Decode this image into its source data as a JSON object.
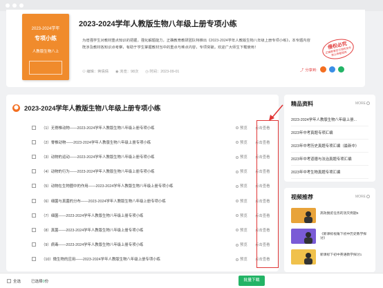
{
  "header": {
    "cover": {
      "year": "2023-2024学年",
      "title": "专项小练",
      "subtitle": "人教版生物八上"
    },
    "title": "2023-2024学年人教版生物八年级上册专项小练",
    "description": "为增强学生对教材重点知识的把握，强化解题能力，正确教育教研团队特推出《2023-2024学年人教版生物八年级上册专项小练》，本专题内容既涉及教材各知识点考察，有助于学生掌握教材当中的重点与难点内容，专项突破。欢迎广大师生下载使用！",
    "meta": {
      "editor_label": "编辑：",
      "editor": "蒋倩倩",
      "views_label": "浏览：",
      "views": "98次",
      "time_label": "时间：",
      "time": "2023-09-01"
    },
    "stamp": {
      "main": "侵权必究",
      "line1": "正确教育官方授权发布",
      "line2": "禁止转载使用"
    },
    "share_label": "分享到:"
  },
  "main": {
    "badge": "",
    "title": "2023-2024学年人教版生物八年级上册专项小练",
    "preview_label": "预览",
    "view_label": "点击查看",
    "items": [
      "（1）无脊椎动物——2023-2024学年人教版生物八年级上册专项小练",
      "（2）脊椎动物——2023-2024学年人教版生物八年级上册专项小练",
      "（3）动物的运动——2023-2024学年人教版生物八年级上册专项小练",
      "（4）动物的行为——2023-2024学年人教版生物八年级上册专项小练",
      "（5）动物在生物圈中的作用——2023-2024学年人教版生物八年级上册专项小练",
      "（6）细菌与真菌的分布——2023-2024学年人教版生物八年级上册专项小练",
      "（7）细菌——2023-2024学年人教版生物八年级上册专项小练",
      "（8）真菌——2023-2024学年人教版生物八年级上册专项小练",
      "（9）病毒——2023-2024学年人教版生物八年级上册专项小练",
      "（10）微生物的应用——2023-2024学年人教版生物八年级上册专项小练"
    ]
  },
  "sidebar": {
    "resources": {
      "title": "精品资料",
      "more": "MORE",
      "items": [
        "2023-2024学年人教版生物八年级上册...",
        "2023年中考真题专项汇编",
        "2023年中考历史真题专项汇编（最新中）",
        "2023年中考道德与法治真题专项汇编",
        "2023年中考生物真题专项汇编"
      ]
    },
    "videos": {
      "title": "视频推荐",
      "more": "MORE",
      "items": [
        "高效脱贫任务的消灭例题5",
        "《新课标视角下初中历史教学探讨》",
        "新课标下初中英语教学探讨1"
      ]
    }
  },
  "bottom": {
    "select_all": "全选",
    "selected_prefix": "已选择",
    "selected_count": "0",
    "selected_suffix": "份",
    "download": "批量下载"
  },
  "colors": {
    "accent": "#f36f21",
    "highlight": "#e03535",
    "download_button": "#23b466",
    "cover": "#f08b2c"
  }
}
